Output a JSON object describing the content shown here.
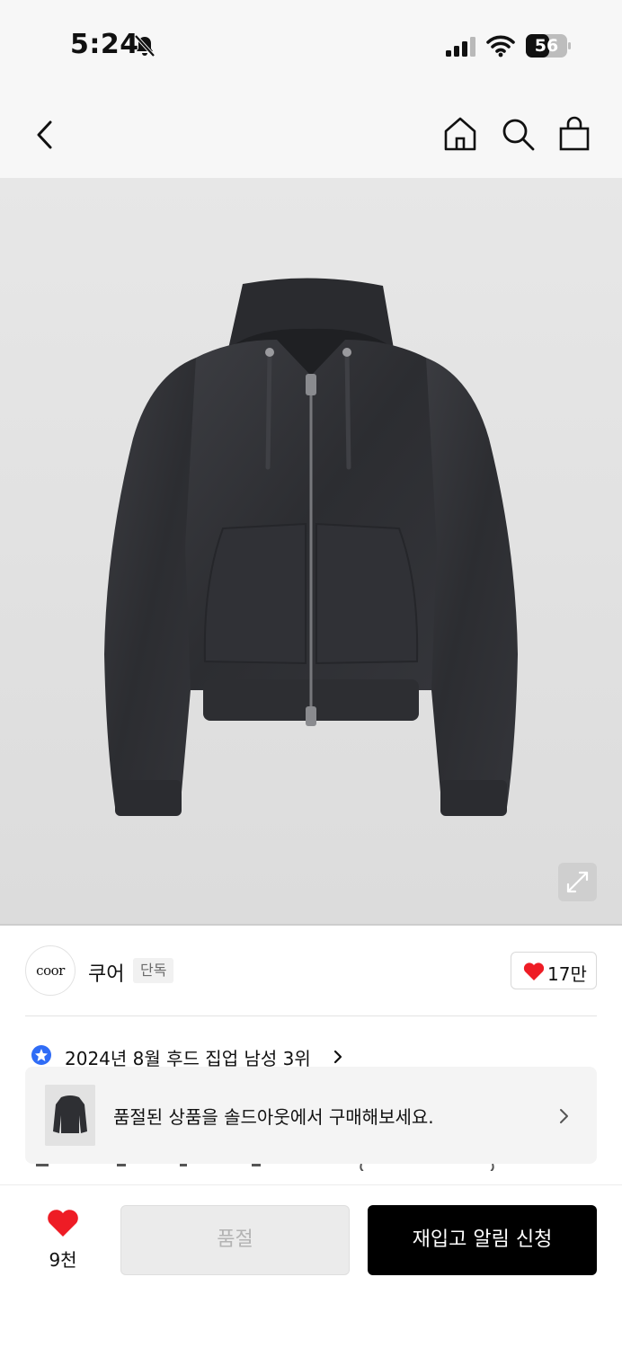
{
  "status_bar": {
    "time": "5:24",
    "battery_level": "56",
    "icons": [
      "bell-off-icon",
      "signal-icon",
      "wifi-icon",
      "battery-icon"
    ]
  },
  "nav": {
    "icons": [
      "back-icon",
      "home-icon",
      "search-icon",
      "bag-icon"
    ]
  },
  "hero": {
    "expand_icon": "expand-icon"
  },
  "brand": {
    "logo_text": "coor",
    "name": "쿠어",
    "tag": "단독",
    "likes": "17만"
  },
  "ranking": {
    "text": "2024년 8월 후드 집업 남성 3위",
    "icon": "star-badge-icon"
  },
  "soldout_banner": {
    "text": "품절된 상품을 솔드아웃에서 구매해보세요."
  },
  "bottom_bar": {
    "favorite_count": "9천",
    "soldout_label": "품절",
    "restock_label": "재입고 알림 신청"
  },
  "colors": {
    "heart": "#ee1c25",
    "rank_badge": "#2f6cf6",
    "primary_button": "#000000",
    "disabled_button": "#ebebeb"
  }
}
